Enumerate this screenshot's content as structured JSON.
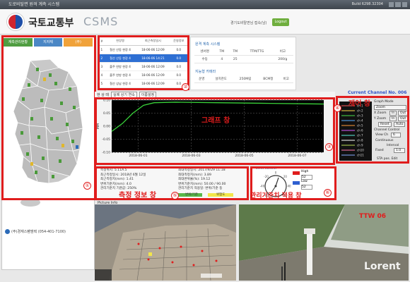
{
  "window": {
    "title": "도로비탈면 원격 계측 시스템",
    "build": "Build 6298.32304"
  },
  "header": {
    "org_name": "국토교통부",
    "app_name": "CSMS",
    "user_info": "경기도비탈면님 접속(남)",
    "logout_label": "Logout"
  },
  "left_panel": {
    "tabs": [
      "계측관리현황",
      "지자체",
      "(주)"
    ],
    "company": "(주)경재스팸엠텍 (054-401-7100)",
    "circle_label": "①"
  },
  "site_list": {
    "circle_label": "②",
    "columns": [
      "#",
      "현장명",
      "최근측정일시",
      "운영정보"
    ],
    "rows": [
      [
        "1",
        "철산 산동 현장 4",
        "18-06-06 12:09",
        "0.0"
      ],
      [
        "2",
        "철산 산동 현장 4",
        "18-06-06 14:21",
        "0.0"
      ],
      [
        "3",
        "출주 연방 현장 4",
        "18-06-06 12:09",
        "0.0"
      ],
      [
        "4",
        "출주 연방 현장 4",
        "18-06-06 12:09",
        "0.0"
      ],
      [
        "5",
        "철산 상남 현장 4",
        "18-06-06 12:09",
        "0.0"
      ]
    ],
    "selected_index": 1
  },
  "info_panel": {
    "title": "원격 계측 시스템",
    "headers": [
      "센서명",
      "TM",
      "TM",
      "TTM/TTG",
      "비고"
    ],
    "values": [
      "수동",
      "4",
      "25",
      "",
      "200/g"
    ],
    "sub_title": "지능형 카메라",
    "sub_values": [
      "운영",
      "설치관도",
      "250M림",
      "BCM정",
      "비고"
    ]
  },
  "graph": {
    "toolbar_label": "현 상 태",
    "select_value": "실제 상기 연속",
    "mode_label": "이름설정",
    "current_channel": "Current Channel No. 006",
    "overlay_label": "그래프 창",
    "circle_label": "③",
    "y_ticks": [
      "0.10",
      "0.05",
      "0.00",
      "-0.05",
      "-0.10"
    ],
    "ylabel": "MM",
    "x_ticks": [
      "2018-06-01",
      "2018-06-03",
      "2018-06-05",
      "2018-06-07"
    ],
    "legend_items": [
      "ch 1",
      "ch 2",
      "ch 3",
      "ch 4",
      "ch 5",
      "ch 6",
      "ch 7",
      "ch 8",
      "ch 9",
      "ch10",
      "ch11"
    ]
  },
  "chart_data": {
    "type": "line",
    "title": "",
    "xlabel": "",
    "ylabel": "MM",
    "ylim": [
      -0.1,
      0.1
    ],
    "series": [
      {
        "name": "",
        "x": [
          0,
          0.05,
          0.1,
          0.15,
          0.2,
          0.3,
          0.5,
          0.7,
          0.9,
          1.0
        ],
        "values": [
          -0.02,
          0.01,
          0.05,
          0.08,
          0.09,
          0.092,
          0.09,
          0.088,
          0.086,
          0.085
        ]
      }
    ]
  },
  "control": {
    "label": "제어 창",
    "graph_mode_label": "Graph Mode",
    "graph_mode_value": "Zoom",
    "x_zoom": "X Zoom",
    "y_zoom": "Y Zoom",
    "reset": "Reset",
    "auto": "Auto",
    "channel_control": "Channel Control",
    "view_ch": "View Ch",
    "view_ch_value": "6",
    "continuous": "Continuous",
    "interval_label": "Interval",
    "interval_value": "1.0",
    "fixed": "Fixed",
    "sta_pos": "STA pos. Edit",
    "circle_label": "④"
  },
  "measure": {
    "label": "측정 정보 창",
    "circle_label": "⑤",
    "lines": [
      "측정위치: 5.11A.5",
      "최근측정일시: 2018년 6월 12일",
      "최근측정치(mm): 1.41",
      "변위기준치(mm): 4.0",
      "관리기준치 기준값: 250%"
    ],
    "lines_right": [
      "최대측정일시: 2017/9/29 11:18",
      "최대측정치(mm): 3.89",
      "최대변위율(%): 19.12",
      "변위기준치(mm): 50.00 / 90.00",
      "관리기준치 적용일: 변위/기준 등"
    ],
    "status": [
      "변위/기준",
      "위험도"
    ]
  },
  "gauge": {
    "title": "Limit Control",
    "label": "관리기준치 적용 창",
    "circle_label": "⑥",
    "high_label": "High",
    "low_label": "Low",
    "high_value": "52",
    "low_value": "52",
    "ticks": [
      "-60",
      "-40",
      "-20",
      "0",
      "20",
      "40",
      "60"
    ]
  },
  "pictures": {
    "title": "Picture Info",
    "camera_label": "TTW 06",
    "watermark": "Lorent"
  }
}
